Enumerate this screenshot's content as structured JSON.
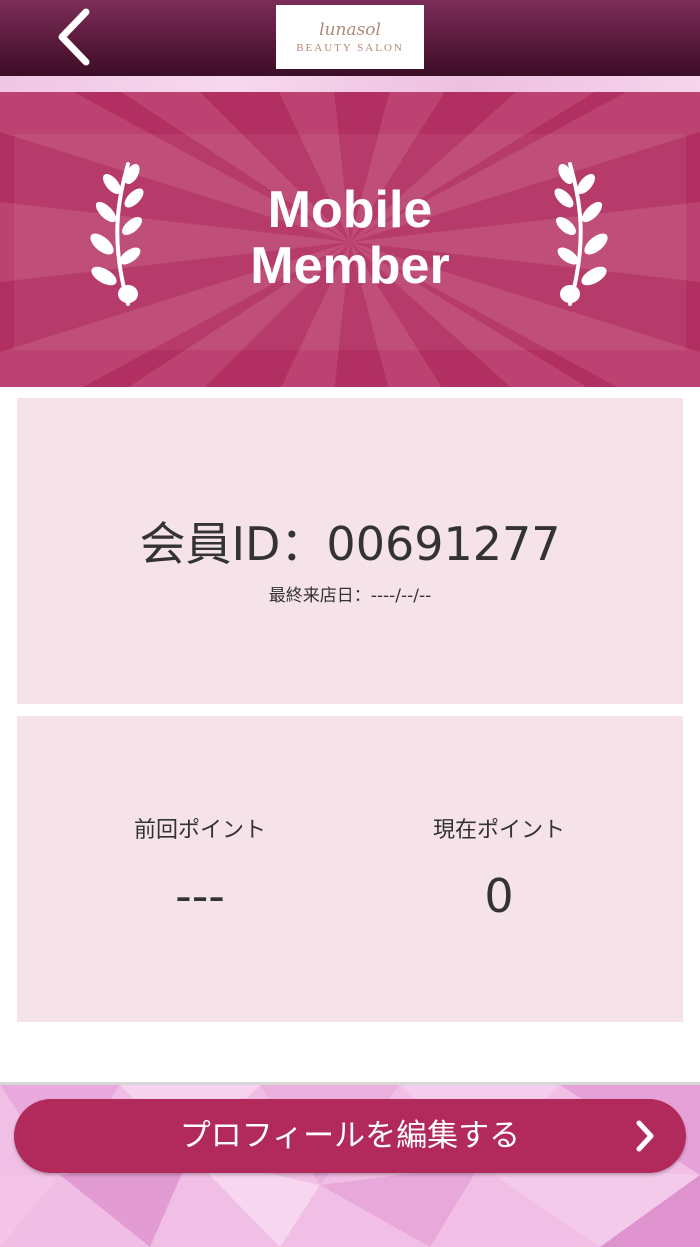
{
  "header": {
    "back_icon": "chevron-left-icon",
    "logo_script": "lunasol",
    "logo_subtitle": "BEAUTY SALON"
  },
  "banner": {
    "title_line1": "Mobile",
    "title_line2": "Member",
    "left_icon": "laurel-branch-icon",
    "right_icon": "laurel-branch-icon"
  },
  "member_card": {
    "member_id": "会員ID：00691277",
    "last_visit": "最終来店日：----/--/--"
  },
  "points_card": {
    "previous_label": "前回ポイント",
    "previous_value": "---",
    "current_label": "現在ポイント",
    "current_value": "0"
  },
  "footer": {
    "edit_profile_label": "プロフィールを編集する",
    "chevron_icon": "chevron-right-icon"
  },
  "colors": {
    "header": "#5a1a3c",
    "banner": "#b22f61",
    "card_background": "#f6e3ea",
    "button": "#b22a5b",
    "footer_background": "#f1bfe6"
  }
}
